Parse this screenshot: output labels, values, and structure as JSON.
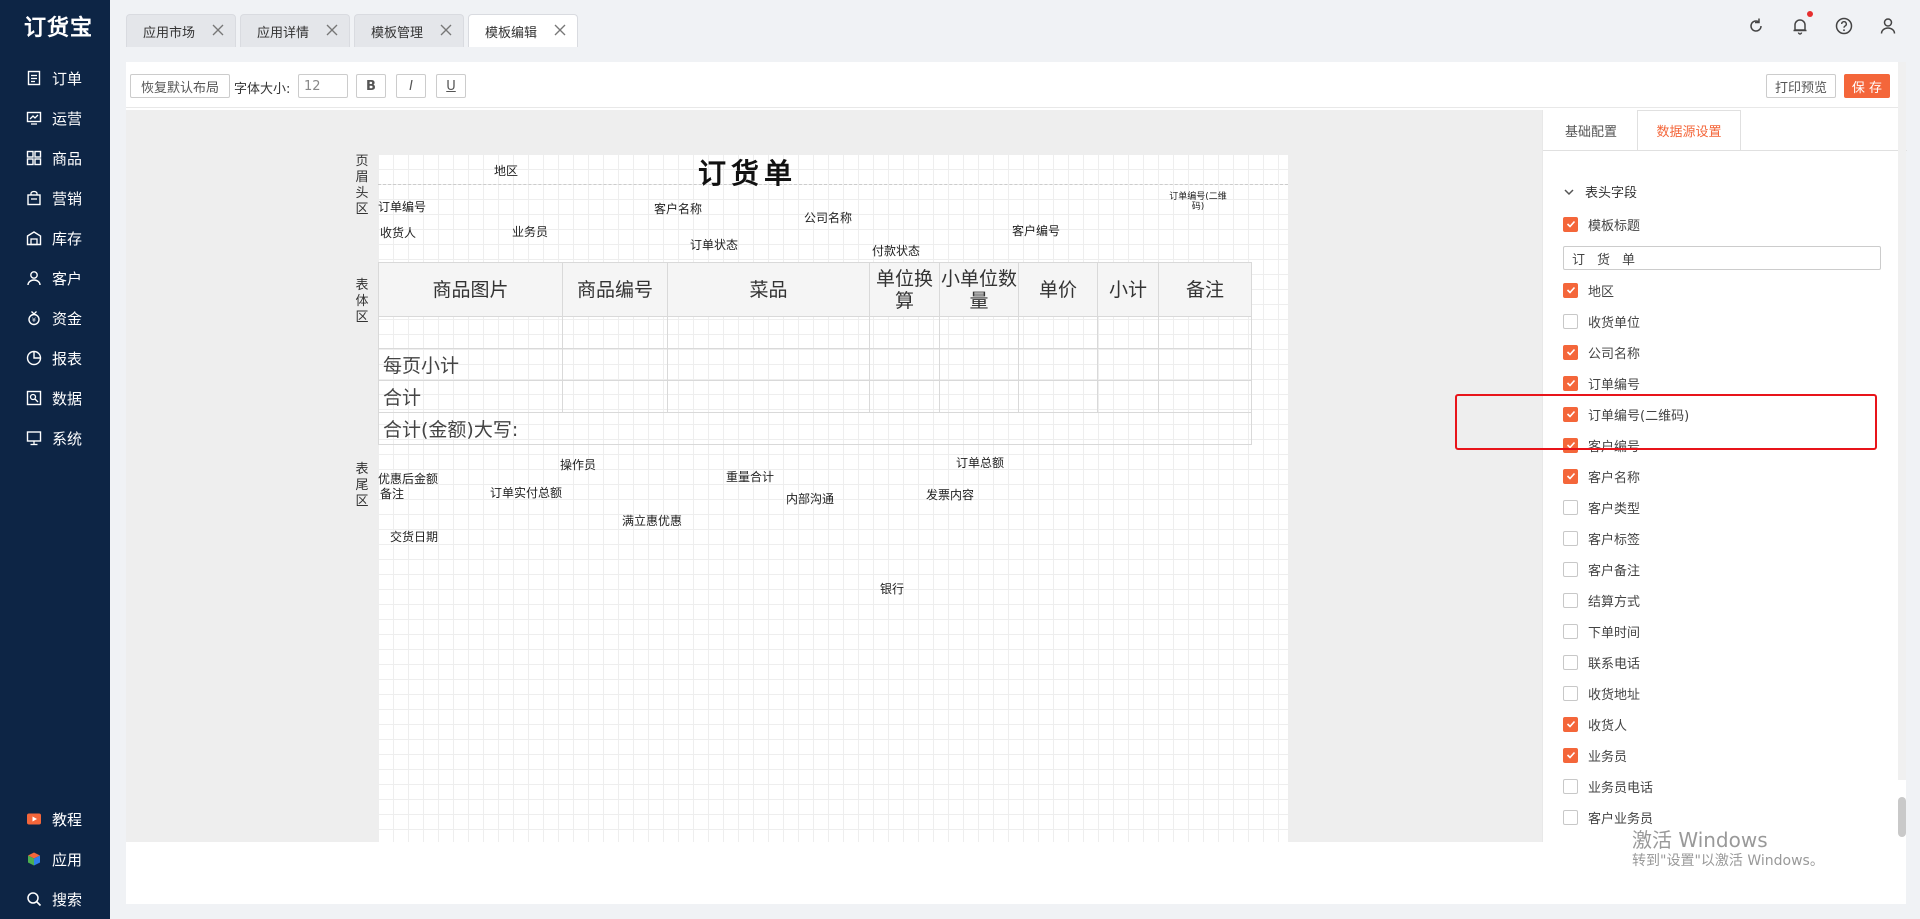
{
  "app": {
    "logo": "订货宝"
  },
  "sidebar": {
    "items": [
      {
        "label": "订单",
        "icon": "order-icon"
      },
      {
        "label": "运营",
        "icon": "operation-icon"
      },
      {
        "label": "商品",
        "icon": "goods-icon"
      },
      {
        "label": "营销",
        "icon": "marketing-icon"
      },
      {
        "label": "库存",
        "icon": "warehouse-icon"
      },
      {
        "label": "客户",
        "icon": "user-icon"
      },
      {
        "label": "资金",
        "icon": "money-bag-icon"
      },
      {
        "label": "报表",
        "icon": "pie-chart-icon"
      },
      {
        "label": "数据",
        "icon": "data-icon"
      },
      {
        "label": "系统",
        "icon": "monitor-icon"
      }
    ],
    "bottom_items": [
      {
        "label": "教程",
        "icon": "play-icon"
      },
      {
        "label": "应用",
        "icon": "cube-icon"
      },
      {
        "label": "搜索",
        "icon": "search-icon"
      }
    ]
  },
  "tabs": [
    {
      "label": "应用市场"
    },
    {
      "label": "应用详情"
    },
    {
      "label": "模板管理"
    },
    {
      "label": "模板编辑",
      "active": true
    }
  ],
  "toolbar": {
    "reset_label": "恢复默认布局",
    "font_size_label": "字体大小:",
    "font_size_value": "12",
    "bold_label": "B",
    "italic_label": "I",
    "underline_label": "U",
    "print_preview_label": "打印预览",
    "save_label": "保 存"
  },
  "template": {
    "title": "订货单",
    "region_header": "页眉头区",
    "region_body": "表体区",
    "region_footer": "表尾区",
    "header_fields": {
      "region": "地区",
      "order_no": "订单编号",
      "customer_name": "客户名称",
      "company_name": "公司名称",
      "qr_order_no": "订单编号(二维码)",
      "receiver": "收货人",
      "salesman": "业务员",
      "customer_no": "客户编号",
      "order_status": "订单状态",
      "payment_status": "付款状态"
    },
    "table": {
      "columns": [
        "商品图片",
        "商品编号",
        "菜品",
        "单位换算",
        "小单位数量",
        "单价",
        "小计",
        "备注"
      ],
      "page_subtotal": "每页小计",
      "total": "合计",
      "total_upper": "合计(金额)大写:"
    },
    "footer_fields": {
      "operator": "操作员",
      "order_total": "订单总额",
      "discounted_amount": "优惠后金额",
      "weight_total": "重量合计",
      "remark": "备注",
      "order_paid_total": "订单实付总额",
      "internal_comm": "内部沟通",
      "invoice_content": "发票内容",
      "instant_discount": "满立惠优惠",
      "delivery_date": "交货日期",
      "bank": "银行"
    }
  },
  "right_panel": {
    "tabs": [
      {
        "label": "基础配置"
      },
      {
        "label": "数据源设置",
        "active": true
      }
    ],
    "section_title": "表头字段",
    "template_title_value": "订货单",
    "fields": [
      {
        "label": "模板标题",
        "checked": true
      },
      {
        "label": "地区",
        "checked": true
      },
      {
        "label": "收货单位",
        "checked": false
      },
      {
        "label": "公司名称",
        "checked": true
      },
      {
        "label": "订单编号",
        "checked": true
      },
      {
        "label": "订单编号(二维码)",
        "checked": true
      },
      {
        "label": "客户编号",
        "checked": true
      },
      {
        "label": "客户名称",
        "checked": true
      },
      {
        "label": "客户类型",
        "checked": false
      },
      {
        "label": "客户标签",
        "checked": false
      },
      {
        "label": "客户备注",
        "checked": false
      },
      {
        "label": "结算方式",
        "checked": false
      },
      {
        "label": "下单时间",
        "checked": false
      },
      {
        "label": "联系电话",
        "checked": false
      },
      {
        "label": "收货地址",
        "checked": false
      },
      {
        "label": "收货人",
        "checked": true
      },
      {
        "label": "业务员",
        "checked": true
      },
      {
        "label": "业务员电话",
        "checked": false
      },
      {
        "label": "客户业务员",
        "checked": false
      }
    ]
  },
  "watermark": {
    "line1": "激活 Windows",
    "line2": "转到\"设置\"以激活 Windows。"
  },
  "colors": {
    "sidebar": "#0d2545",
    "accent": "#f4663a",
    "highlight": "#e8141a"
  }
}
